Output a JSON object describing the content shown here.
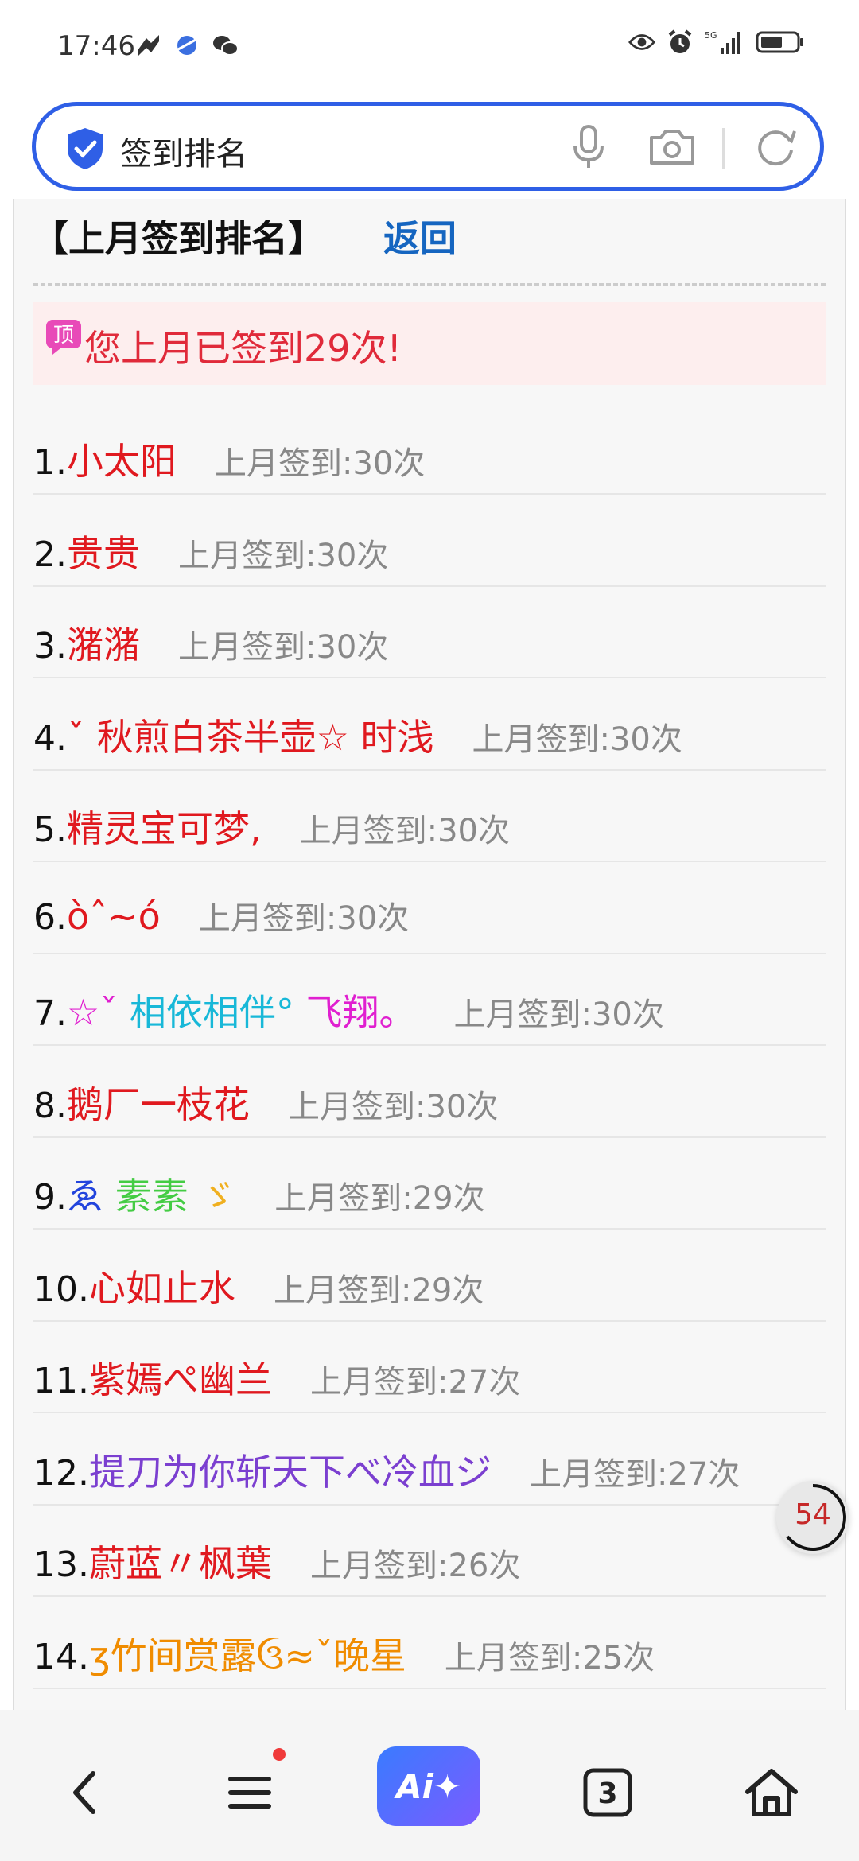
{
  "status_bar": {
    "time": "17:46",
    "network_label": "5G"
  },
  "search_bar": {
    "query": "签到排名"
  },
  "page": {
    "heading": "【上月签到排名】",
    "back_link": "返回",
    "notice_icon_label": "顶",
    "notice": "您上月已签到29次!"
  },
  "ranking": [
    {
      "rank": "1.",
      "name": "小太阳",
      "color": "#e0191f",
      "stat": "上月签到:30次"
    },
    {
      "rank": "2.",
      "name": "贵贵",
      "color": "#e0191f",
      "stat": "上月签到:30次"
    },
    {
      "rank": "3.",
      "name": "潴潴",
      "color": "#e0191f",
      "stat": "上月签到:30次"
    },
    {
      "rank": "4.",
      "name": "ˇ 秋煎白茶半壶☆ 时浅",
      "color": "#e0191f",
      "stat": "上月签到:30次"
    },
    {
      "rank": "5.",
      "name": "精灵宝可梦,",
      "color": "#e0191f",
      "stat": "上月签到:30次"
    },
    {
      "rank": "6.",
      "name": "òˆ~ó",
      "color": "#e0191f",
      "stat": "上月签到:30次"
    },
    {
      "rank": "7.",
      "name_parts": [
        {
          "text": "☆ˇ ",
          "color": "#e020d0"
        },
        {
          "text": "相依相伴°",
          "color": "#18b8d8"
        },
        {
          "text": " 飞翔。",
          "color": "#e020d0"
        }
      ],
      "stat": "上月签到:30次"
    },
    {
      "rank": "8.",
      "name": "鹅厂一枝花",
      "color": "#e0191f",
      "stat": "上月签到:30次"
    },
    {
      "rank": "9.",
      "name_parts": [
        {
          "text": "ゑ",
          "color": "#2244dd"
        },
        {
          "text": " 素素",
          "color": "#44cc44"
        },
        {
          "text": " ゞ",
          "color": "#f0b020"
        }
      ],
      "stat": "上月签到:29次"
    },
    {
      "rank": "10.",
      "name": "心如止水",
      "color": "#e0191f",
      "stat": "上月签到:29次"
    },
    {
      "rank": "11.",
      "name": "紫嫣ぺ幽兰",
      "color": "#e0191f",
      "stat": "上月签到:27次"
    },
    {
      "rank": "12.",
      "name": "提刀为你斩天下べ冷血ジ",
      "color": "#7b3fd0",
      "stat": "上月签到:27次"
    },
    {
      "rank": "13.",
      "name": "蔚蓝〃枫葉",
      "color": "#e0191f",
      "stat": "上月签到:26次"
    },
    {
      "rank": "14.",
      "name": "ʒ竹间赏露ઉ≈ˇ晚星",
      "color": "#f08c00",
      "stat": "上月签到:25次"
    }
  ],
  "floating_badge": "54",
  "bottom_nav": {
    "ai_label": "Ai✦",
    "tab_count": "3"
  }
}
